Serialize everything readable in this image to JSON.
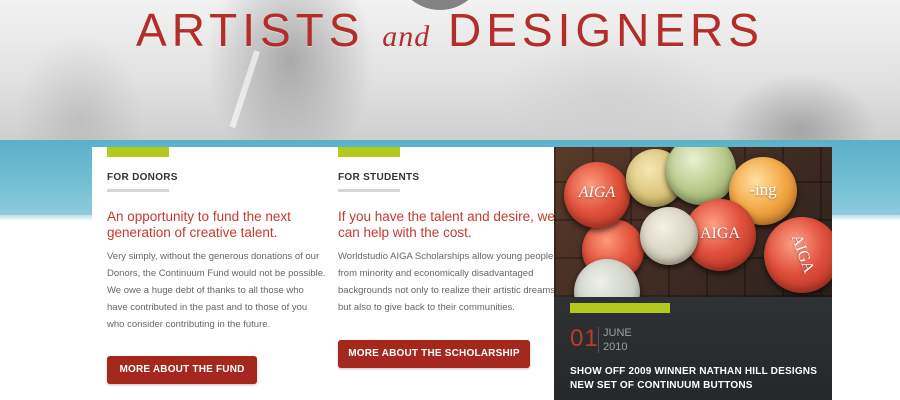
{
  "hero": {
    "title_part1": "ARTISTS",
    "title_and": "and",
    "title_part2": "DESIGNERS"
  },
  "donors": {
    "heading": "FOR DONORS",
    "tagline": "An opportunity to fund the next generation of creative talent.",
    "body": "Very simply, without the generous donations of our Donors, the Continuum Fund would not be possible. We owe a huge debt of thanks to all those who have contributed in the past and to those of you who consider contributing in the future.",
    "button_label": "MORE ABOUT THE FUND"
  },
  "students": {
    "heading": "FOR STUDENTS",
    "tagline": "If you have the talent and desire, we can help with the cost.",
    "body": "Worldstudio AIGA Scholarships allow young people from minority and economically disadvantaged backgrounds not only to realize their artistic dreams, but also to give back to their communities.",
    "button_label": "MORE ABOUT THE SCHOLARSHIP"
  },
  "news": {
    "photo_pins": [
      "AIGA",
      "AIGA",
      "-ing",
      "AIGA"
    ],
    "day": "01",
    "month": "JUNE",
    "year": "2010",
    "headline": "SHOW OFF 2009 WINNER NATHAN HILL DESIGNS NEW SET OF CONTINUUM BUTTONS"
  },
  "colors": {
    "accent_red": "#b32d2a",
    "button_red": "#a5281f",
    "accent_green": "#b4c91d",
    "strip_blue": "#6cbad0",
    "news_dark": "#2f3133"
  }
}
